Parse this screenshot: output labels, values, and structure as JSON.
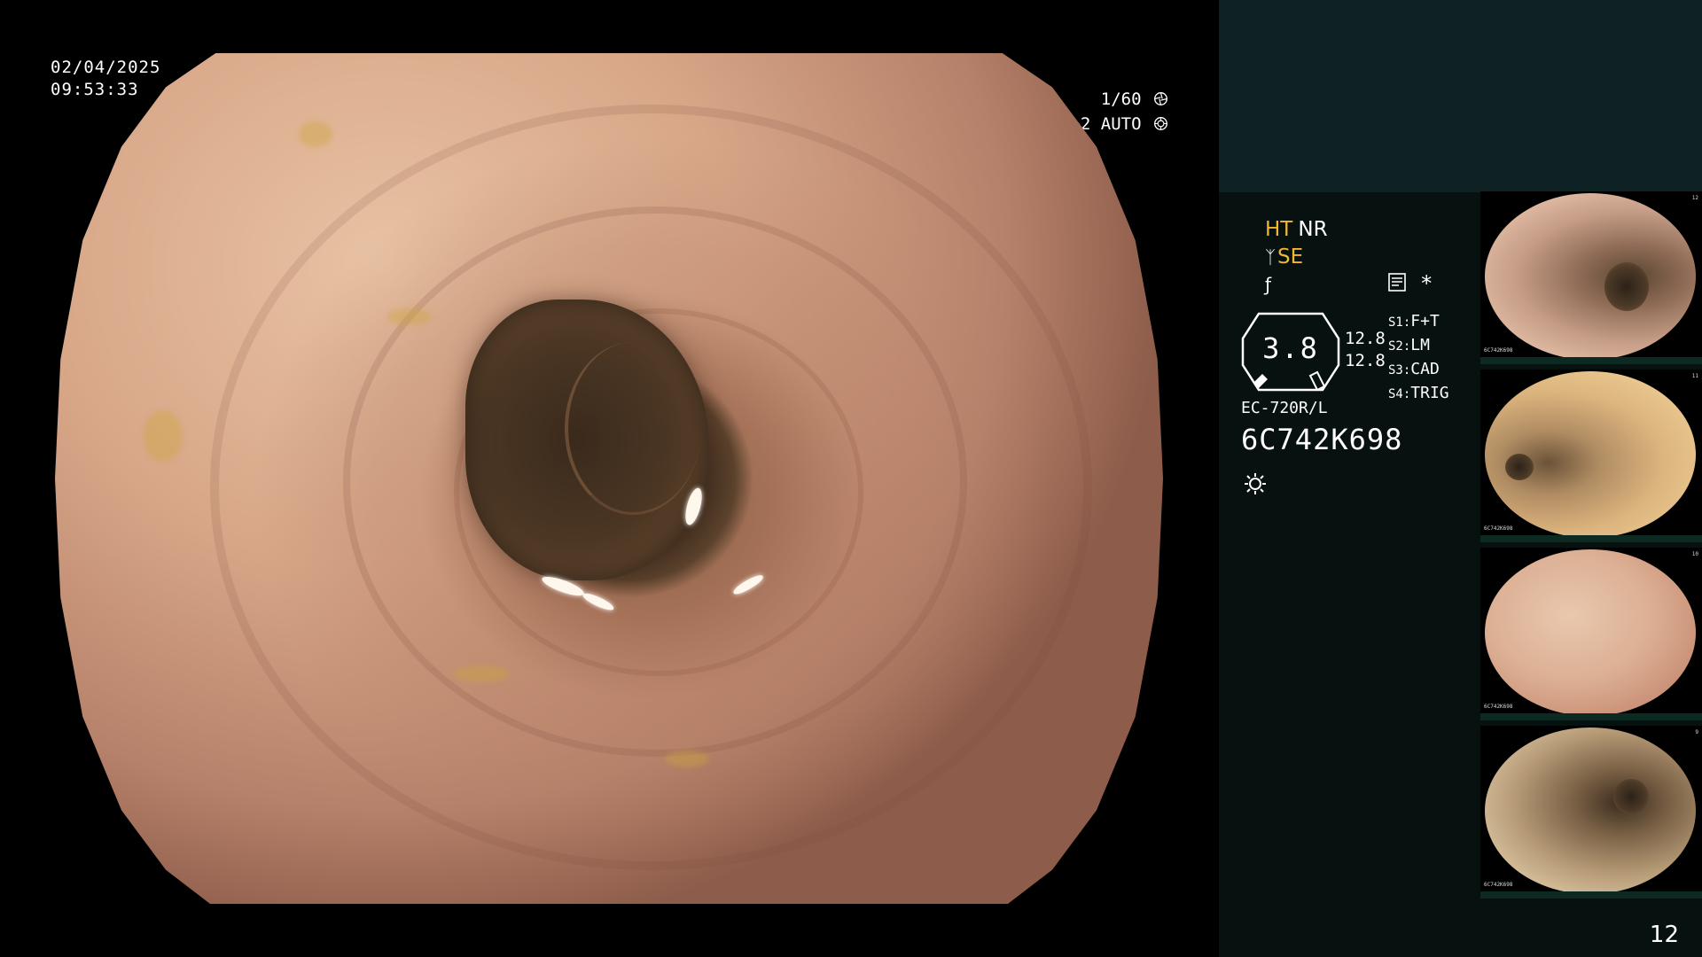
{
  "overlay": {
    "date": "02/04/2025",
    "time": "09:53:33",
    "shutter": "1/60",
    "level": "Lv+2 AUTO",
    "shutter_icon": "aperture-icon",
    "auto_icon": "iris-icon"
  },
  "panel": {
    "ht": "HT",
    "nr": "NR",
    "se": "SE",
    "zoom_value": "3.8",
    "zoom_side_1": "12.8",
    "zoom_side_2": "12.8",
    "switches": [
      {
        "key": "S1:",
        "value": "F+T"
      },
      {
        "key": "S2:",
        "value": "LM"
      },
      {
        "key": "S3:",
        "value": "CAD"
      },
      {
        "key": "S4:",
        "value": "TRIG"
      }
    ],
    "model": "EC-720R/L",
    "serial": "6C742K698",
    "page_number": "12",
    "asterisk": "*"
  },
  "colors": {
    "accent_yellow": "#f3b634",
    "panel_top": "#0e2123",
    "panel": "#07110f"
  },
  "thumbnails": [
    {
      "caption": "6C742K698",
      "index": "12"
    },
    {
      "caption": "6C742K698",
      "index": "11"
    },
    {
      "caption": "6C742K698",
      "index": "10"
    },
    {
      "caption": "6C742K698",
      "index": "9"
    }
  ]
}
